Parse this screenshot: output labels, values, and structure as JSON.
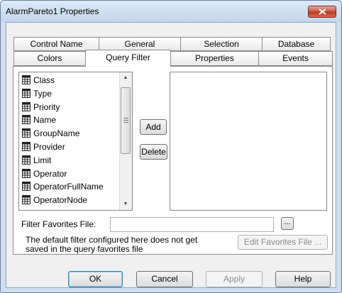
{
  "window": {
    "title": "AlarmPareto1 Properties"
  },
  "tabs": {
    "row1": [
      "Control Name",
      "General",
      "Selection",
      "Database"
    ],
    "row2": [
      "Colors",
      "Query Filter",
      "Properties",
      "Events"
    ],
    "active": "Query Filter"
  },
  "fields_list": {
    "items": [
      "Class",
      "Type",
      "Priority",
      "Name",
      "GroupName",
      "Provider",
      "Limit",
      "Operator",
      "OperatorFullName",
      "OperatorNode"
    ]
  },
  "buttons": {
    "add": "Add",
    "delete": "Delete",
    "browse": "...",
    "edit_favorites": "Edit Favorites File ..."
  },
  "filter_favorites": {
    "label": "Filter Favorites File:",
    "value": ""
  },
  "note": {
    "line1": "The default filter configured here does not get",
    "line2": "saved in the query favorites file"
  },
  "footer": {
    "ok": "OK",
    "cancel": "Cancel",
    "apply": "Apply",
    "help": "Help"
  },
  "icon_names": [
    "close-icon",
    "field-icon",
    "scroll-up-arrow-icon",
    "scroll-down-arrow-icon"
  ]
}
